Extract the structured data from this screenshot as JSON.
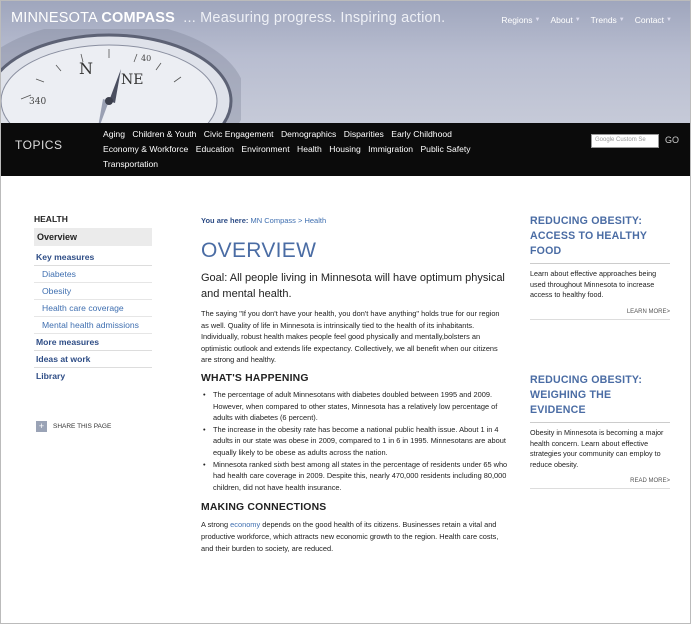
{
  "header": {
    "site_name_prefix": "MINNESOTA",
    "site_name_bold": "COMPASS",
    "tagline": "... Measuring progress. Inspiring action.",
    "nav": [
      "Regions",
      "About",
      "Trends",
      "Contact"
    ]
  },
  "topics": {
    "label": "TOPICS",
    "links": [
      "Aging",
      "Children & Youth",
      "Civic Engagement",
      "Demographics",
      "Disparities",
      "Early Childhood",
      "Economy & Workforce",
      "Education",
      "Environment",
      "Health",
      "Housing",
      "Immigration",
      "Public Safety",
      "Transportation"
    ],
    "search_placeholder": "Google Custom Se",
    "go_label": "GO"
  },
  "leftnav": {
    "heading": "HEALTH",
    "overview": "Overview",
    "key_measures": "Key measures",
    "sub_items": [
      "Diabetes",
      "Obesity",
      "Health care coverage",
      "Mental health admissions"
    ],
    "more_measures": "More measures",
    "ideas": "Ideas at work",
    "library": "Library",
    "share": "SHARE THIS PAGE"
  },
  "main": {
    "crumb_label": "You are here:",
    "crumb_path": "MN Compass > Health",
    "title": "OVERVIEW",
    "goal": "Goal: All people living in Minnesota will have optimum physical and mental health.",
    "intro": "The saying \"If you don't have your health, you don't have anything\" holds true for our region as well. Quality of life in Minnesota is intrinsically tied to the health of its inhabitants. Individually, robust health makes people feel good physically and mentally,bolsters an optimistic outlook and extends life expectancy. Collectively, we all benefit when our citizens are strong and healthy.",
    "happening_heading": "WHAT'S HAPPENING",
    "bullets": [
      "The percentage of adult Minnesotans with diabetes doubled between 1995 and 2009. However, when compared to other states, Minnesota has a relatively low percentage of adults with diabetes (6 percent).",
      "The increase in the obesity rate has become a national public health issue. About 1 in 4 adults in our state was obese in 2009, compared to 1 in 6 in 1995. Minnesotans are about equally likely to be obese as adults across the nation.",
      "Minnesota ranked sixth best among all states in the percentage of residents under 65 who had health care coverage in 2009. Despite this, nearly 470,000 residents including 80,000 children, did not have health insurance."
    ],
    "connections_heading": "MAKING CONNECTIONS",
    "connections_pre": "A strong ",
    "connections_link": "economy",
    "connections_post": " depends on the good health of its citizens. Businesses retain a vital and productive workforce, which attracts new economic growth to the region. Health care costs, and their burden to society, are reduced."
  },
  "sidebar": [
    {
      "title": "REDUCING OBESITY: ACCESS TO HEALTHY FOOD",
      "text": "Learn about effective approaches being used throughout Minnesota to increase access to healthy food.",
      "more": "LEARN MORE>"
    },
    {
      "title": "REDUCING OBESITY: WEIGHING THE EVIDENCE",
      "text": "Obesity in Minnesota is becoming a major health concern. Learn about effective strategies your community can employ to reduce obesity.",
      "more": "READ MORE>"
    }
  ]
}
